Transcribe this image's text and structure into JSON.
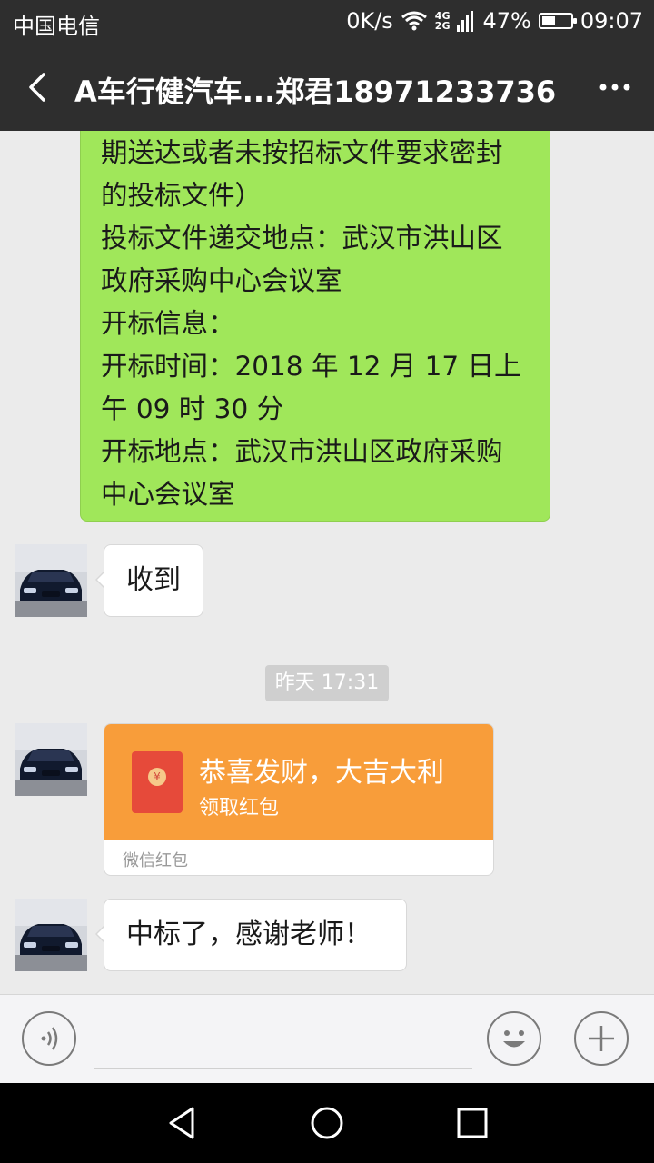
{
  "status_bar": {
    "carrier": "中国电信",
    "speed": "0K/s",
    "network_top": "4G",
    "network_bottom": "2G",
    "battery": "47%",
    "battery_level": 0.47,
    "time": "09:07"
  },
  "header": {
    "title": "A车行健汽车...郑君18971233736",
    "back_icon": "back-arrow-icon",
    "more_icon": "more-dots-icon"
  },
  "messages": {
    "outgoing_lines": [
      "期送达或者未按招标文件要求密封",
      "的投标文件）",
      "投标文件递交地点：武汉市洪山区",
      "政府采购中心会议室",
      "开标信息：",
      "开标时间：2018 年 12 月 17 日上",
      "午 09 时 30 分",
      "开标地点：武汉市洪山区政府采购",
      "中心会议室"
    ],
    "reply1": "收到",
    "timestamp": "昨天 17:31",
    "red_packet": {
      "title": "恭喜发财，大吉大利",
      "action": "领取红包",
      "footer": "微信红包"
    },
    "reply2": "中标了，感谢老师！"
  },
  "input_bar": {
    "voice_icon": "voice-icon",
    "emoji_icon": "emoji-icon",
    "add_icon": "plus-icon",
    "value": ""
  },
  "colors": {
    "header_bg": "#2e2e2e",
    "chat_bg": "#ebebeb",
    "outgoing_bubble": "#a0e75a",
    "red_packet": "#f89d3a"
  }
}
